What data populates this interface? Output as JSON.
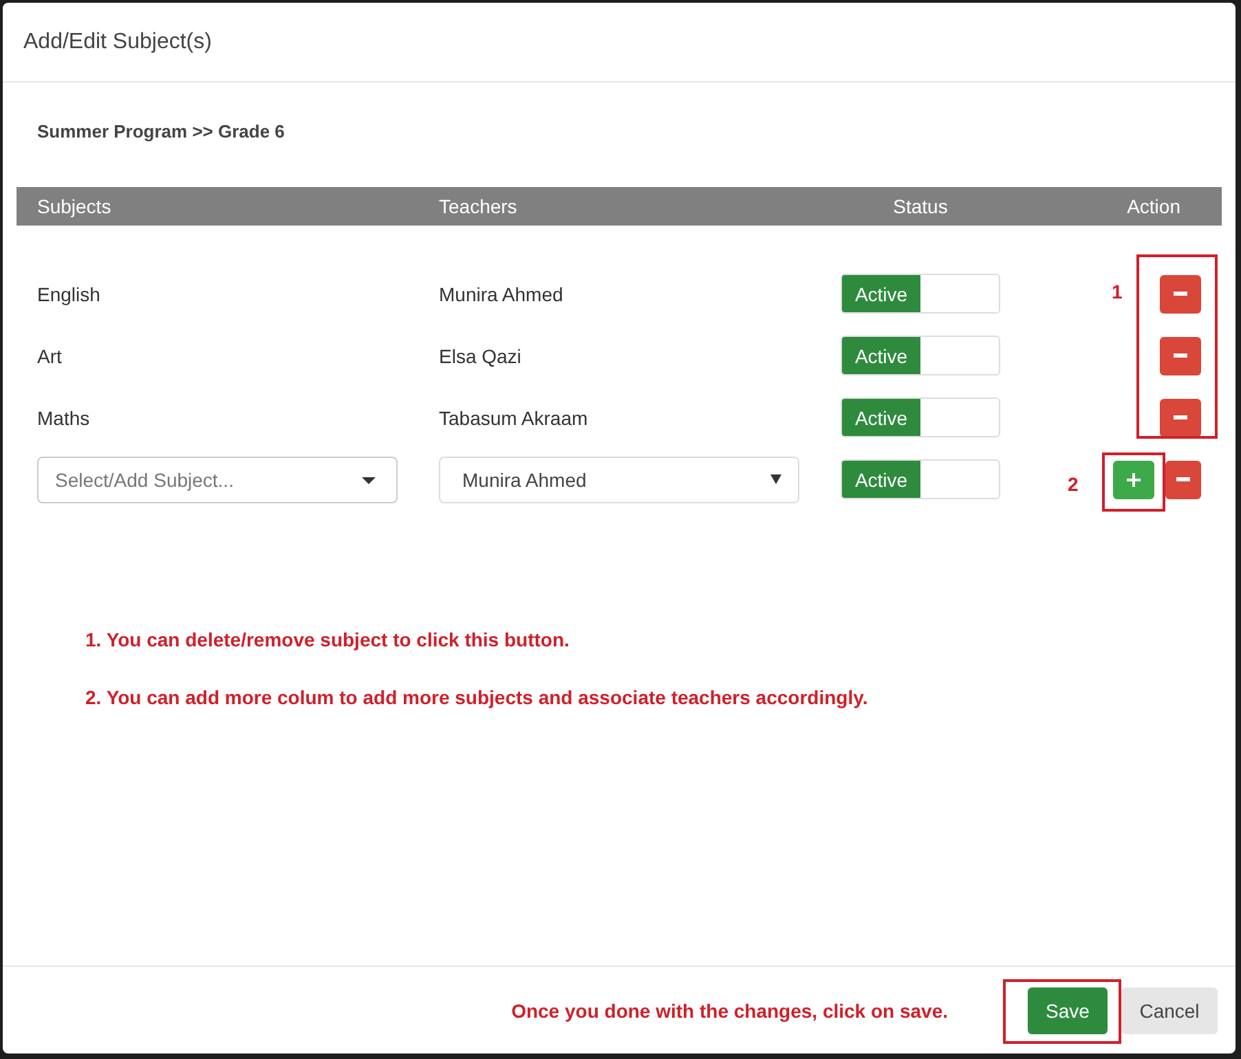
{
  "dialog": {
    "title": "Add/Edit Subject(s)"
  },
  "breadcrumb": "Summer Program >> Grade 6",
  "table": {
    "columns": [
      "Subjects",
      "Teachers",
      "Status",
      "Action"
    ],
    "rows": [
      {
        "subject": "English",
        "teacher": "Munira Ahmed",
        "status": "Active",
        "on": true
      },
      {
        "subject": "Art",
        "teacher": "Elsa Qazi",
        "status": "Active",
        "on": true
      },
      {
        "subject": "Maths",
        "teacher": "Tabasum Akraam",
        "status": "Active",
        "on": true
      }
    ]
  },
  "new_row": {
    "subject_placeholder": "Select/Add Subject...",
    "teacher": "Munira Ahmed",
    "status": "Active",
    "on": true
  },
  "callouts": [
    {
      "label": "1"
    },
    {
      "label": "2"
    }
  ],
  "notes": [
    "1. You can delete/remove subject to click this button.",
    "2. You can add more colum to add more subjects and associate teachers accordingly."
  ],
  "footer": {
    "note": "Once you done with the changes, click on save.",
    "buttons": [
      {
        "label": "Save",
        "kind": "primary"
      },
      {
        "label": "Cancel",
        "kind": "secondary"
      }
    ]
  }
}
